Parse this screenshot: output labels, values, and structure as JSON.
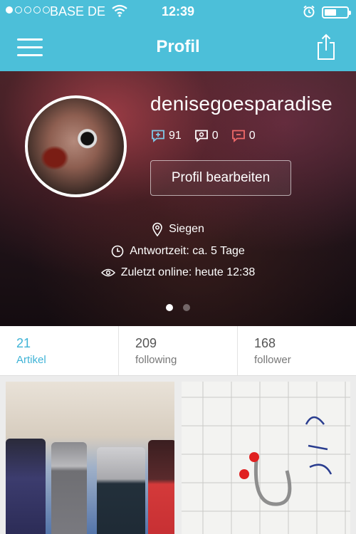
{
  "status_bar": {
    "carrier": "BASE DE",
    "time": "12:39"
  },
  "nav": {
    "title": "Profil"
  },
  "profile": {
    "username": "denisegoesparadise",
    "stats": {
      "questions": "91",
      "answers": "0",
      "comments": "0"
    },
    "edit_button_label": "Profil bearbeiten",
    "location": "Siegen",
    "response_time": "Antwortzeit: ca. 5 Tage",
    "last_online": "Zuletzt online: heute 12:38"
  },
  "tabs": [
    {
      "count": "21",
      "label": "Artikel"
    },
    {
      "count": "209",
      "label": "following"
    },
    {
      "count": "168",
      "label": "follower"
    }
  ],
  "colors": {
    "accent": "#4cbfd9",
    "active_tab": "#3fb3d6"
  }
}
